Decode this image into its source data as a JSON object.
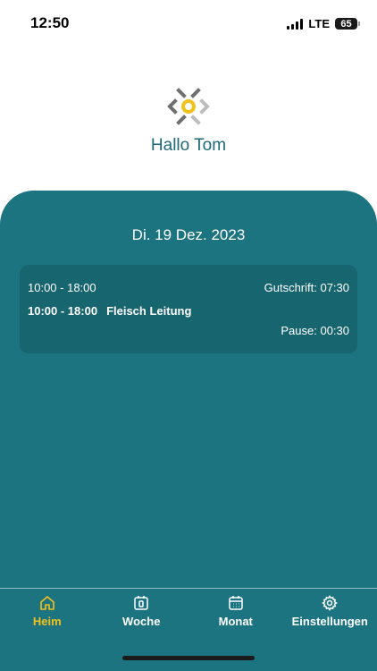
{
  "status_bar": {
    "time": "12:50",
    "network": "LTE",
    "battery": "65"
  },
  "header": {
    "greeting": "Hallo Tom"
  },
  "main": {
    "date": "Di. 19 Dez. 2023",
    "shift": {
      "time_range": "10:00 - 18:00",
      "credit": "Gutschrift: 07:30",
      "assignment_time": "10:00 - 18:00",
      "assignment_name": "Fleisch Leitung",
      "pause": "Pause: 00:30"
    }
  },
  "bottom_nav": {
    "items": [
      {
        "label": "Heim",
        "icon": "home-icon",
        "active": true
      },
      {
        "label": "Woche",
        "icon": "calendar-day-icon",
        "active": false
      },
      {
        "label": "Monat",
        "icon": "calendar-month-icon",
        "active": false
      },
      {
        "label": "Einstellungen",
        "icon": "gear-icon",
        "active": false
      }
    ]
  },
  "colors": {
    "panel": "#1c7480",
    "card": "#17656f",
    "accent": "#f2c11c",
    "greeting": "#1c6a77"
  }
}
